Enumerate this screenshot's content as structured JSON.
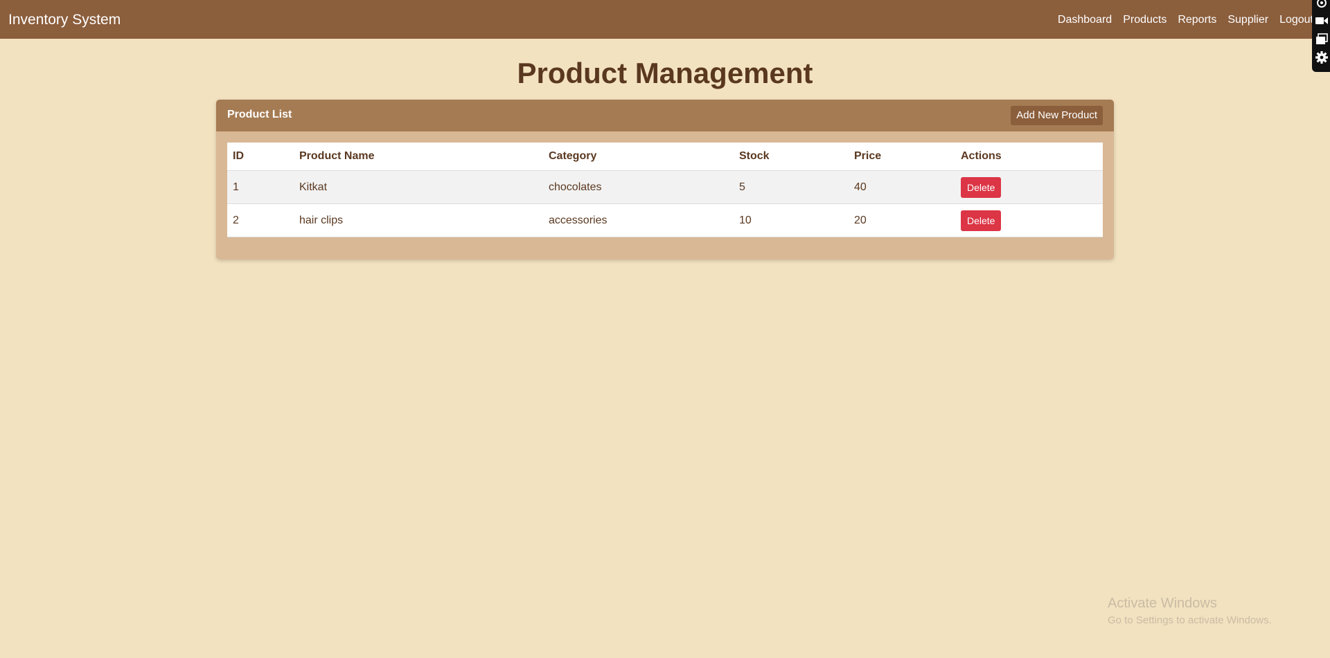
{
  "navbar": {
    "brand": "Inventory System",
    "links": [
      "Dashboard",
      "Products",
      "Reports",
      "Supplier",
      "Logout"
    ]
  },
  "toolbar": {
    "icons": [
      "record-icon",
      "video-camera-icon",
      "windows-icon",
      "gear-icon"
    ]
  },
  "page": {
    "title": "Product Management"
  },
  "card": {
    "title": "Product List",
    "add_button": "Add New Product"
  },
  "table": {
    "columns": [
      "ID",
      "Product Name",
      "Category",
      "Stock",
      "Price",
      "Actions"
    ],
    "rows": [
      {
        "id": "1",
        "name": "Kitkat",
        "category": "chocolates",
        "stock": "5",
        "price": "40",
        "action": "Delete"
      },
      {
        "id": "2",
        "name": "hair clips",
        "category": "accessories",
        "stock": "10",
        "price": "20",
        "action": "Delete"
      }
    ]
  },
  "watermark": {
    "title": "Activate Windows",
    "subtitle": "Go to Settings to activate Windows."
  },
  "colors": {
    "background": "#f3e2c0",
    "navbar": "#8b5e3c",
    "card_header": "#a57b53",
    "card_body": "#d9b896",
    "delete_button": "#dc3545",
    "text": "#5a3820"
  }
}
